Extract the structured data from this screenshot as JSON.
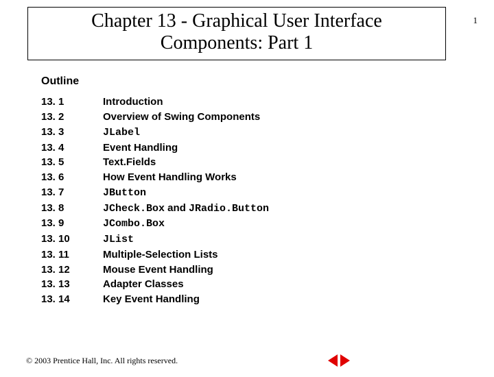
{
  "page_number": "1",
  "title": {
    "line1": "Chapter 13 - Graphical User Interface",
    "line2": "Components: Part 1"
  },
  "outline_label": "Outline",
  "outline": [
    {
      "num": "13. 1",
      "parts": [
        {
          "text": "Introduction",
          "mono": false
        }
      ]
    },
    {
      "num": "13. 2",
      "parts": [
        {
          "text": "Overview of Swing Components",
          "mono": false
        }
      ]
    },
    {
      "num": "13. 3",
      "parts": [
        {
          "text": "JLabel",
          "mono": true
        }
      ]
    },
    {
      "num": "13. 4",
      "parts": [
        {
          "text": "Event Handling",
          "mono": false
        }
      ]
    },
    {
      "num": "13. 5",
      "parts": [
        {
          "text": "Text.Fields",
          "mono": false
        }
      ]
    },
    {
      "num": "13. 6",
      "parts": [
        {
          "text": "How Event Handling Works",
          "mono": false
        }
      ]
    },
    {
      "num": "13. 7",
      "parts": [
        {
          "text": "JButton",
          "mono": true
        }
      ]
    },
    {
      "num": "13. 8",
      "parts": [
        {
          "text": "JCheck.Box",
          "mono": true
        },
        {
          "text": " and ",
          "mono": false
        },
        {
          "text": "JRadio.Button",
          "mono": true
        }
      ]
    },
    {
      "num": "13. 9",
      "parts": [
        {
          "text": "JCombo.Box",
          "mono": true
        }
      ]
    },
    {
      "num": "13. 10",
      "parts": [
        {
          "text": "JList",
          "mono": true
        }
      ]
    },
    {
      "num": "13. 11",
      "parts": [
        {
          "text": "Multiple-Selection Lists",
          "mono": false
        }
      ]
    },
    {
      "num": "13. 12",
      "parts": [
        {
          "text": "Mouse Event Handling",
          "mono": false
        }
      ]
    },
    {
      "num": "13. 13",
      "parts": [
        {
          "text": "Adapter Classes",
          "mono": false
        }
      ]
    },
    {
      "num": "13. 14",
      "parts": [
        {
          "text": "Key Event Handling",
          "mono": false
        }
      ]
    }
  ],
  "copyright": "© 2003 Prentice Hall, Inc. All rights reserved."
}
